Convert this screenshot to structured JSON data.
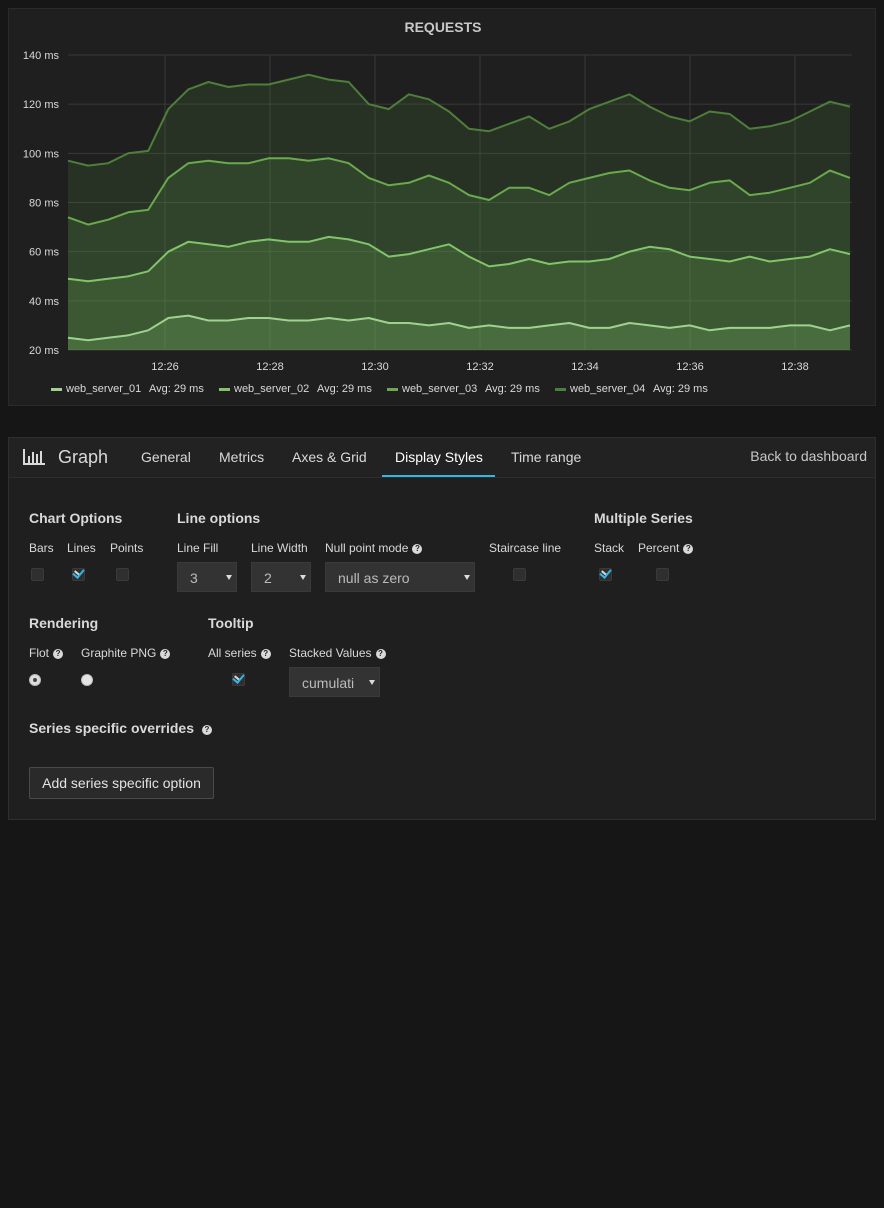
{
  "panel": {
    "title": "REQUESTS"
  },
  "chart_data": {
    "type": "area",
    "stacked": true,
    "title": "REQUESTS",
    "x": [
      "12:26",
      "12:28",
      "12:30",
      "12:32",
      "12:34",
      "12:36",
      "12:38"
    ],
    "y_ticks": [
      "20 ms",
      "40 ms",
      "60 ms",
      "80 ms",
      "100 ms",
      "120 ms",
      "140 ms"
    ],
    "ylim": [
      20,
      140
    ],
    "grid": true,
    "legend_position": "bottom",
    "series": [
      {
        "name": "web_server_01",
        "avg": "Avg: 29 ms",
        "color": "#9fd28f",
        "values": [
          25,
          24,
          25,
          26,
          28,
          33,
          34,
          32,
          32,
          33,
          33,
          32,
          32,
          33,
          32,
          33,
          31,
          31,
          30,
          31,
          29,
          30,
          29,
          29,
          30,
          31,
          29,
          29,
          31,
          30,
          29,
          30,
          28,
          29,
          29,
          29,
          30,
          30,
          28,
          30
        ]
      },
      {
        "name": "web_server_02",
        "avg": "Avg: 29 ms",
        "color": "#82c46a",
        "values": [
          49,
          48,
          49,
          50,
          52,
          60,
          64,
          63,
          62,
          64,
          65,
          64,
          64,
          66,
          65,
          63,
          58,
          59,
          61,
          63,
          58,
          54,
          55,
          57,
          55,
          56,
          56,
          57,
          60,
          62,
          61,
          58,
          57,
          56,
          58,
          56,
          57,
          58,
          61,
          59
        ]
      },
      {
        "name": "web_server_03",
        "avg": "Avg: 29 ms",
        "color": "#6aa94e",
        "values": [
          74,
          71,
          73,
          76,
          77,
          90,
          96,
          97,
          96,
          96,
          98,
          98,
          97,
          98,
          96,
          90,
          87,
          88,
          91,
          88,
          83,
          81,
          86,
          86,
          83,
          88,
          90,
          92,
          93,
          89,
          86,
          85,
          88,
          89,
          83,
          84,
          86,
          88,
          93,
          90
        ]
      },
      {
        "name": "web_server_04",
        "avg": "Avg: 29 ms",
        "color": "#4e7f3a",
        "values": [
          97,
          95,
          96,
          100,
          101,
          118,
          126,
          129,
          127,
          128,
          128,
          130,
          132,
          130,
          129,
          120,
          118,
          124,
          122,
          117,
          110,
          109,
          112,
          115,
          110,
          113,
          118,
          121,
          124,
          119,
          115,
          113,
          117,
          116,
          110,
          111,
          113,
          117,
          121,
          119
        ]
      }
    ]
  },
  "editor": {
    "title": "Graph",
    "tabs": [
      "General",
      "Metrics",
      "Axes & Grid",
      "Display Styles",
      "Time range"
    ],
    "active_tab": "Display Styles",
    "back_label": "Back to dashboard",
    "chart_options": {
      "heading": "Chart Options",
      "bars_label": "Bars",
      "lines_label": "Lines",
      "points_label": "Points",
      "bars": false,
      "lines": true,
      "points": false
    },
    "line_options": {
      "heading": "Line options",
      "fill_label": "Line Fill",
      "fill_value": "3",
      "width_label": "Line Width",
      "width_value": "2",
      "null_label": "Null point mode",
      "null_value": "null as zero",
      "staircase_label": "Staircase line",
      "staircase": false
    },
    "multiple_series": {
      "heading": "Multiple Series",
      "stack_label": "Stack",
      "stack": true,
      "percent_label": "Percent",
      "percent": false
    },
    "rendering": {
      "heading": "Rendering",
      "flot_label": "Flot",
      "png_label": "Graphite PNG",
      "selected": "Flot"
    },
    "tooltip": {
      "heading": "Tooltip",
      "all_series_label": "All series",
      "all_series": true,
      "stacked_label": "Stacked Values",
      "stacked_value": "cumulati"
    },
    "overrides": {
      "heading": "Series specific overrides",
      "add_button": "Add series specific option"
    }
  }
}
